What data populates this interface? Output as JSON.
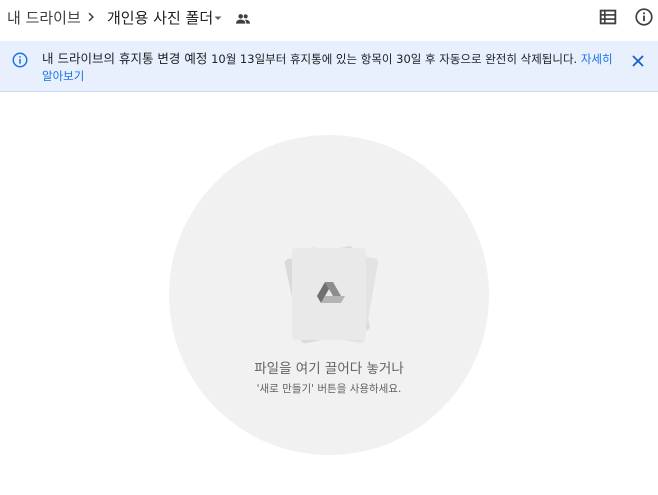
{
  "breadcrumb": {
    "root": "내 드라이브",
    "separator_icon": "chevron-right-icon",
    "current": "개인용 사진 폴더",
    "dropdown_icon": "caret-down-icon",
    "shared_icon": "people-icon"
  },
  "toolbar": {
    "list_view_icon": "list-view-icon",
    "info_icon": "info-icon"
  },
  "banner": {
    "icon": "info-icon",
    "title": "내 드라이브의 휴지통 변경 예정",
    "message": "10월 13일부터 휴지통에 있는 항목이 30일 후 자동으로 완전히 삭제됩니다.",
    "link": "자세히 알아보기",
    "close_icon": "close-icon",
    "background": "#e8f0fe",
    "accent": "#1a73e8"
  },
  "empty_state": {
    "title": "파일을 여기 끌어다 놓거나",
    "subtitle": "'새로 만들기' 버튼을 사용하세요.",
    "art_icon": "drive-logo-icon"
  }
}
